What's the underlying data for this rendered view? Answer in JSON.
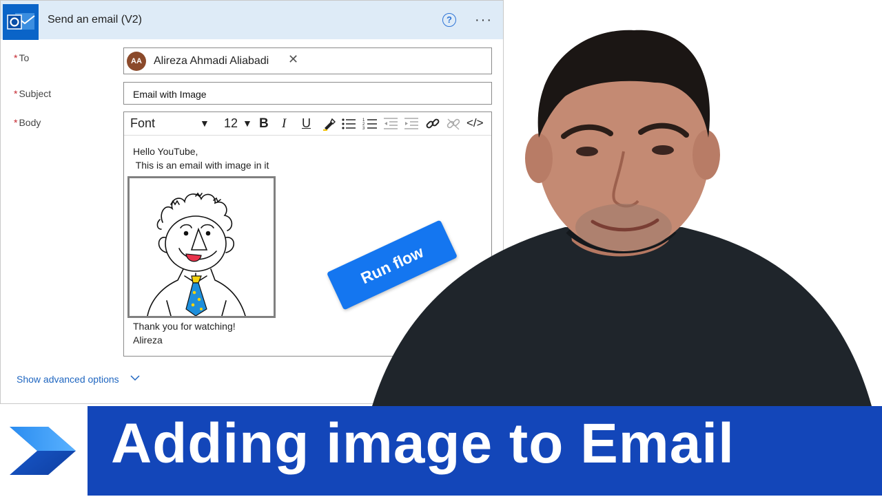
{
  "card": {
    "title": "Send an email (V2)",
    "help_glyph": "?",
    "more_glyph": "···"
  },
  "fields": {
    "to_label": "To",
    "subject_label": "Subject",
    "body_label": "Body",
    "required_mark": "*"
  },
  "to": {
    "avatar_initials": "AA",
    "recipient": "Alireza Ahmadi Aliabadi",
    "remove_glyph": "✕"
  },
  "subject": {
    "value": "Email with Image"
  },
  "body_toolbar": {
    "font": "Font",
    "font_size": "12",
    "caret": "▼",
    "bold": "B",
    "italic": "I",
    "underline": "U",
    "code": "</>"
  },
  "body_content": {
    "line1": "Hello YouTube,",
    "line2": " This is an email with image in it",
    "line3": "Thank you for watching!",
    "line4": "Alireza"
  },
  "advanced_options": "Show advanced options",
  "run_flow": "Run flow",
  "banner": {
    "title": "Adding image to Email"
  },
  "colors": {
    "header_bg": "#deebf7",
    "accent_blue": "#1476f0",
    "banner_blue": "#1346b9",
    "required_red": "#c4262e"
  },
  "icons": [
    "outlook-icon",
    "help-icon",
    "more-icon",
    "remove-icon",
    "bold-icon",
    "italic-icon",
    "underline-icon",
    "highlight-icon",
    "bullet-list-icon",
    "numbered-list-icon",
    "decrease-indent-icon",
    "increase-indent-icon",
    "link-icon",
    "unlink-icon",
    "code-view-icon",
    "chevron-down-icon",
    "power-automate-logo"
  ]
}
